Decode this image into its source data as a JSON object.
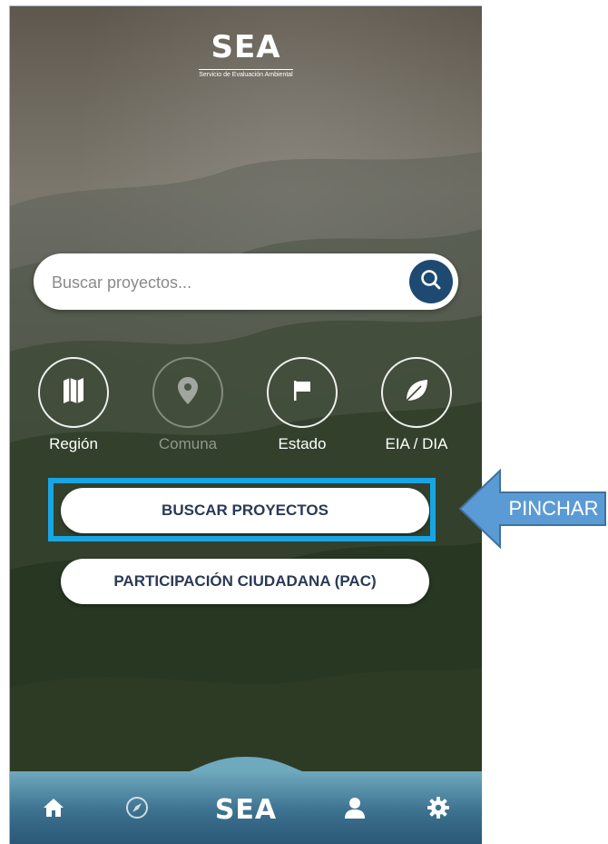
{
  "app": {
    "logo_text": "SEA",
    "logo_subtitle": "Servicio de Evaluación Ambiental"
  },
  "search": {
    "placeholder": "Buscar proyectos...",
    "icon": "search-icon"
  },
  "filters": [
    {
      "label": "Región",
      "icon": "map-icon",
      "enabled": true
    },
    {
      "label": "Comuna",
      "icon": "location-pin-icon",
      "enabled": false
    },
    {
      "label": "Estado",
      "icon": "flag-icon",
      "enabled": true
    },
    {
      "label": "EIA / DIA",
      "icon": "leaf-icon",
      "enabled": true
    }
  ],
  "actions": {
    "search_projects": "BUSCAR PROYECTOS",
    "citizen_participation": "PARTICIPACIÓN CIUDADANA (PAC)"
  },
  "bottom_nav": {
    "items": [
      "home-icon",
      "compass-icon",
      "sea-logo",
      "user-icon",
      "settings-icon"
    ],
    "logo_text": "SEA"
  },
  "annotation": {
    "callout_text": "PINCHAR",
    "highlight_color": "#17a6e3",
    "callout_color": "#5b9bd5"
  },
  "colors": {
    "primary": "#1e4a72",
    "button_text": "#2a3a55",
    "nav_top": "#6fa9bd",
    "nav_bottom": "#2b5877"
  }
}
